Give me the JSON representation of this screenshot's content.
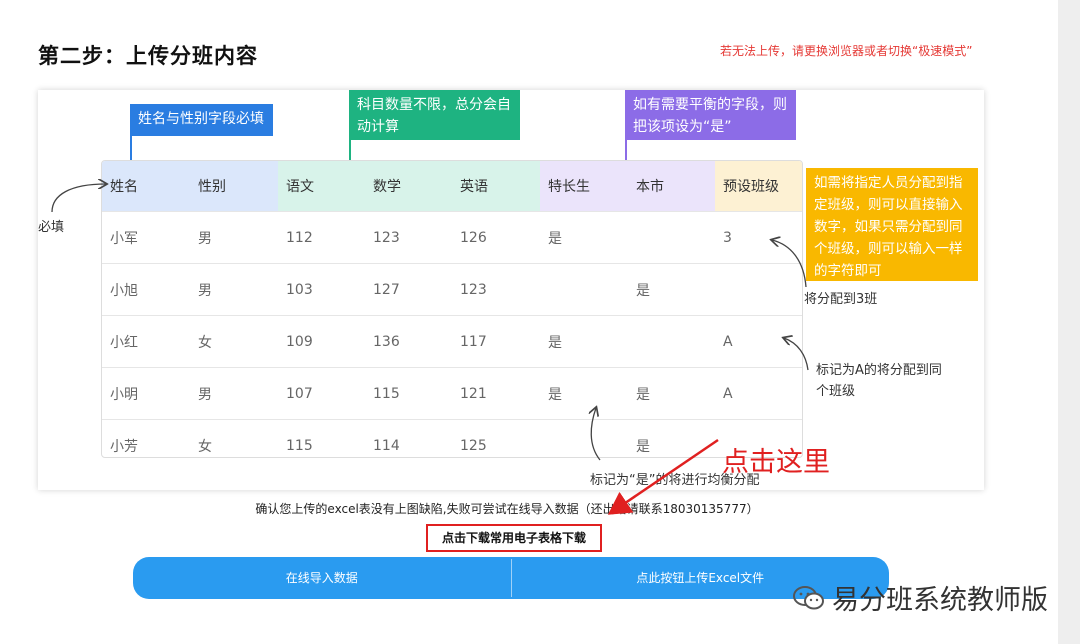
{
  "header": {
    "title": "第二步：上传分班内容",
    "warning": "若无法上传，请更换浏览器或者切换“极速模式”"
  },
  "tags": {
    "name_gender": "姓名与性别字段必填",
    "subjects": "科目数量不限，总分会自动计算",
    "balance": "如有需要平衡的字段，则把该项设为“是”",
    "preset": "如需将指定人员分配到指定班级，则可以直接输入数字，如果只需分配到同个班级，则可以输入一样的字符即可"
  },
  "table": {
    "headers": [
      "姓名",
      "性别",
      "语文",
      "数学",
      "英语",
      "特长生",
      "本市",
      "预设班级"
    ],
    "rows": [
      [
        "小军",
        "男",
        "112",
        "123",
        "126",
        "是",
        "",
        "3"
      ],
      [
        "小旭",
        "男",
        "103",
        "127",
        "123",
        "",
        "是",
        ""
      ],
      [
        "小红",
        "女",
        "109",
        "136",
        "117",
        "是",
        "",
        "A"
      ],
      [
        "小明",
        "男",
        "107",
        "115",
        "121",
        "是",
        "是",
        "A"
      ],
      [
        "小芳",
        "女",
        "115",
        "114",
        "125",
        "",
        "是",
        ""
      ]
    ]
  },
  "notes": {
    "required": "必填",
    "class3": "将分配到3班",
    "markA": "标记为A的将分配到同个班级",
    "balanced": "标记为“是”的将进行均衡分配"
  },
  "footer": {
    "confirm": "确认您上传的excel表没有上图缺陷,失败可尝试在线导入数据（还出错请联系18030135777）",
    "download_button": "点击下载常用电子表格下载",
    "online_import": "在线导入数据",
    "upload_excel": "点此按钮上传Excel文件"
  },
  "annotation": {
    "click_here": "点击这里"
  },
  "watermark": {
    "text": "易分班系统教师版",
    "icon": "wechat-icon"
  },
  "colors": {
    "blue": "#2a7de1",
    "green": "#1eb381",
    "purple": "#8c6ce7",
    "yellow": "#f9b800",
    "button": "#2a9bf0",
    "red": "#e02020"
  }
}
